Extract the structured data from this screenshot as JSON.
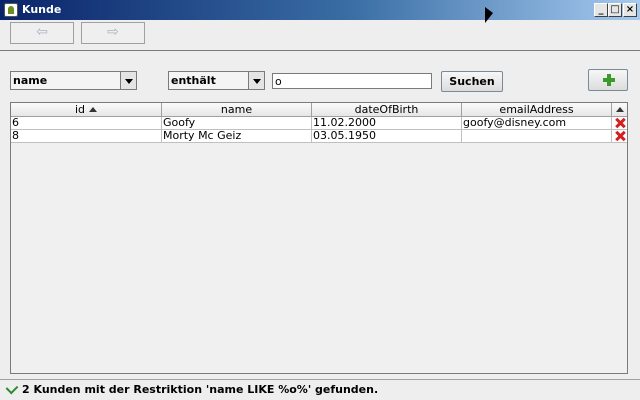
{
  "window": {
    "title": "Kunde"
  },
  "nav": {
    "back_glyph": "⇦",
    "forward_glyph": "⇨"
  },
  "search": {
    "field_selected": "name",
    "operator_selected": "enthält",
    "value": "o",
    "button_label": "Suchen"
  },
  "table": {
    "columns": [
      {
        "label": "id",
        "sorted": "asc"
      },
      {
        "label": "name"
      },
      {
        "label": "dateOfBirth"
      },
      {
        "label": "emailAddress"
      }
    ],
    "rows": [
      {
        "id": "6",
        "name": "Goofy",
        "dateOfBirth": "11.02.2000",
        "emailAddress": "goofy@disney.com"
      },
      {
        "id": "8",
        "name": "Morty Mc Geiz",
        "dateOfBirth": "03.05.1950",
        "emailAddress": ""
      }
    ]
  },
  "status": {
    "text": "2 Kunden mit der Restriktion 'name LIKE %o%' gefunden."
  },
  "icons": {
    "delete": "x-icon",
    "add": "plus-icon",
    "status": "check-icon"
  },
  "colors": {
    "title_start": "#0a246a",
    "title_end": "#a6caf0",
    "delete": "#d41f1f",
    "add": "#3a9a2a"
  }
}
